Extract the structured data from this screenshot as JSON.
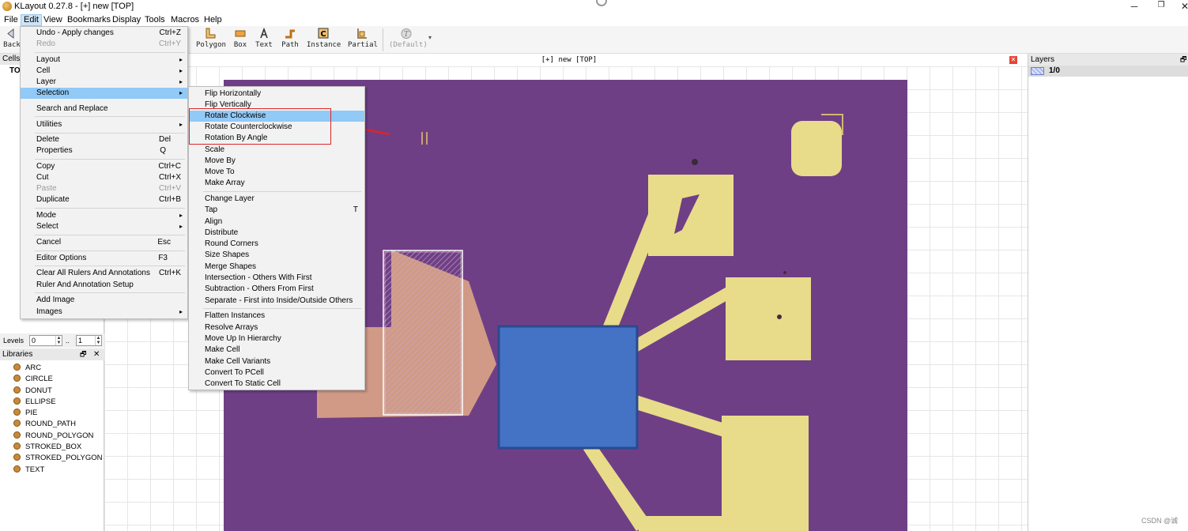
{
  "window": {
    "title": "KLayout 0.27.8 - [+] new [TOP]",
    "minimize_glyph": "─",
    "maximize_glyph": "❐",
    "close_glyph": "✕"
  },
  "menubar": [
    {
      "label": "File"
    },
    {
      "label": "Edit"
    },
    {
      "label": "View"
    },
    {
      "label": "Bookmarks"
    },
    {
      "label": "Display"
    },
    {
      "label": "Tools"
    },
    {
      "label": "Macros"
    },
    {
      "label": "Help"
    }
  ],
  "toolbar": {
    "back_label": "Back",
    "tools": [
      {
        "label": "Polygon",
        "icon": "polygon-icon"
      },
      {
        "label": "Box",
        "icon": "box-icon"
      },
      {
        "label": "Text",
        "icon": "text-icon"
      },
      {
        "label": "Path",
        "icon": "path-icon"
      },
      {
        "label": "Instance",
        "icon": "instance-icon"
      },
      {
        "label": "Partial",
        "icon": "partial-icon"
      }
    ],
    "style_label": "(Default)"
  },
  "cells": {
    "header": "Cells",
    "top_cell": "TO"
  },
  "levels": {
    "label": "Levels",
    "from": "0",
    "sep": "..",
    "to": "1"
  },
  "libraries": {
    "header": "Libraries",
    "float_glyph": "🗗",
    "close_glyph": "✕",
    "items": [
      "ARC",
      "CIRCLE",
      "DONUT",
      "ELLIPSE",
      "PIE",
      "ROUND_PATH",
      "ROUND_POLYGON",
      "STROKED_BOX",
      "STROKED_POLYGON",
      "TEXT"
    ]
  },
  "canvas": {
    "title": "[+] new [TOP]",
    "close_glyph": "✕",
    "accent": "#6f3f86",
    "pad_color": "#e8dc8a",
    "shape_fill": "#4472c4"
  },
  "layers": {
    "header": "Layers",
    "float_glyph": "🗗",
    "layer_name": "1/0"
  },
  "edit_menu": {
    "items": [
      {
        "label": "Undo - Apply changes",
        "shortcut": "Ctrl+Z"
      },
      {
        "label": "Redo",
        "shortcut": "Ctrl+Y",
        "disabled": true
      },
      {
        "label": "Layout",
        "submenu": true
      },
      {
        "label": "Cell",
        "submenu": true
      },
      {
        "label": "Layer",
        "submenu": true
      },
      {
        "label": "Selection",
        "submenu": true,
        "highlighted": true
      },
      {
        "label": "Search and Replace"
      },
      {
        "label": "Utilities",
        "submenu": true
      },
      {
        "label": "Delete",
        "shortcut": "Del"
      },
      {
        "label": "Properties",
        "shortcut": "Q"
      },
      {
        "label": "Copy",
        "shortcut": "Ctrl+C"
      },
      {
        "label": "Cut",
        "shortcut": "Ctrl+X"
      },
      {
        "label": "Paste",
        "shortcut": "Ctrl+V",
        "disabled": true
      },
      {
        "label": "Duplicate",
        "shortcut": "Ctrl+B"
      },
      {
        "label": "Mode",
        "submenu": true
      },
      {
        "label": "Select",
        "submenu": true
      },
      {
        "label": "Cancel",
        "shortcut": "Esc"
      },
      {
        "label": "Editor Options",
        "shortcut": "F3"
      },
      {
        "label": "Clear All Rulers And Annotations",
        "shortcut": "Ctrl+K"
      },
      {
        "label": "Ruler And Annotation Setup"
      },
      {
        "label": "Add Image"
      },
      {
        "label": "Images",
        "submenu": true
      }
    ],
    "submenu_glyph": "▸"
  },
  "selection_menu": {
    "items": [
      {
        "label": "Flip Horizontally"
      },
      {
        "label": "Flip Vertically"
      },
      {
        "label": "Rotate Clockwise",
        "highlighted": true
      },
      {
        "label": "Rotate Counterclockwise"
      },
      {
        "label": "Rotation By Angle"
      },
      {
        "label": "Scale"
      },
      {
        "label": "Move By"
      },
      {
        "label": "Move To"
      },
      {
        "label": "Make Array"
      },
      {
        "label": "Change Layer"
      },
      {
        "label": "Tap",
        "shortcut": "T"
      },
      {
        "label": "Align"
      },
      {
        "label": "Distribute"
      },
      {
        "label": "Round Corners"
      },
      {
        "label": "Size Shapes"
      },
      {
        "label": "Merge Shapes"
      },
      {
        "label": "Intersection - Others With First"
      },
      {
        "label": "Subtraction - Others From First"
      },
      {
        "label": "Separate - First into Inside/Outside Others"
      },
      {
        "label": "Flatten Instances"
      },
      {
        "label": "Resolve Arrays"
      },
      {
        "label": "Move Up In Hierarchy"
      },
      {
        "label": "Make Cell"
      },
      {
        "label": "Make Cell Variants"
      },
      {
        "label": "Convert To PCell"
      },
      {
        "label": "Convert To Static Cell"
      }
    ]
  },
  "annotation_color": "#e02424",
  "watermark": "CSDN @诚"
}
